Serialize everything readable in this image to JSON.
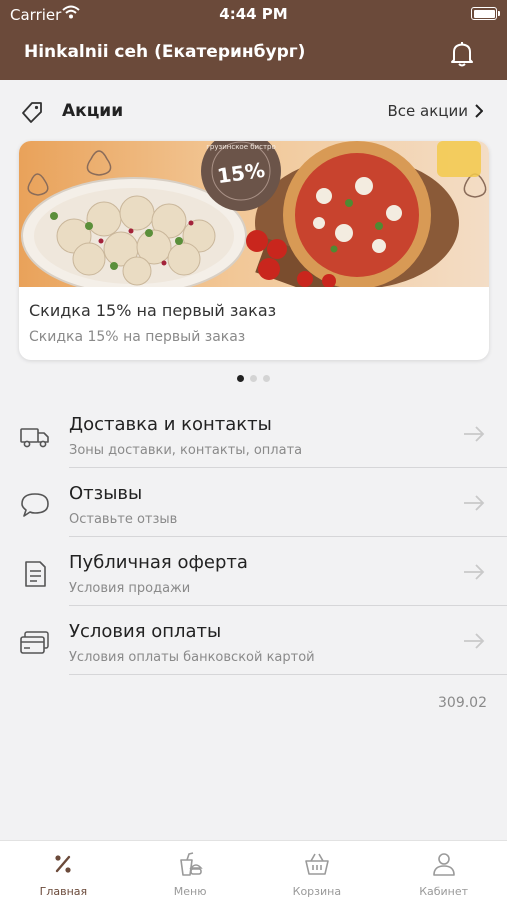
{
  "status_bar": {
    "carrier": "Carrier",
    "time": "4:44 PM"
  },
  "app_bar": {
    "title": "Hinkalnii ceh (Екатеринбург)"
  },
  "promo": {
    "heading": "Акции",
    "all_label": "Все акции",
    "card": {
      "title": "Скидка 15% на первый заказ",
      "subtitle": "Скидка 15% на первый заказ",
      "badge_percent": "15%",
      "badge_ring_text": "грузинское бистро"
    },
    "pages": 3,
    "active_page": 1
  },
  "menu_items": [
    {
      "title": "Доставка и контакты",
      "subtitle": "Зоны доставки, контакты, оплата",
      "icon": "truck-icon"
    },
    {
      "title": "Отзывы",
      "subtitle": "Оставьте отзыв",
      "icon": "chat-bubble-icon"
    },
    {
      "title": "Публичная оферта",
      "subtitle": "Условия продажи",
      "icon": "document-icon"
    },
    {
      "title": "Условия оплаты",
      "subtitle": "Условия оплаты банковской картой",
      "icon": "credit-card-icon"
    }
  ],
  "version": "309.02",
  "tab_bar": [
    {
      "label": "Главная",
      "icon": "percent-icon",
      "active": true
    },
    {
      "label": "Меню",
      "icon": "food-menu-icon",
      "active": false
    },
    {
      "label": "Корзина",
      "icon": "basket-icon",
      "active": false
    },
    {
      "label": "Кабинет",
      "icon": "user-icon",
      "active": false
    }
  ],
  "colors": {
    "brand": "#6b4a3a",
    "background": "#f2f2f3",
    "muted_text": "#8a8a8a"
  }
}
